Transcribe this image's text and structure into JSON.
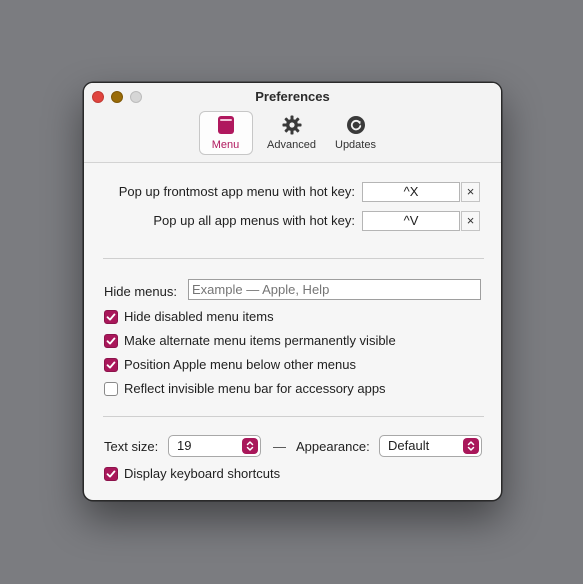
{
  "window": {
    "title": "Preferences"
  },
  "toolbar": {
    "items": [
      {
        "label": "Menu",
        "icon": "menu-book-icon",
        "selected": true
      },
      {
        "label": "Advanced",
        "icon": "gear-icon",
        "selected": false
      },
      {
        "label": "Updates",
        "icon": "update-refresh-icon",
        "selected": false
      }
    ]
  },
  "hotkeys": {
    "frontmost_label": "Pop up frontmost app menu with hot key:",
    "frontmost_value": "^X",
    "all_label": "Pop up all app menus with hot key:",
    "all_value": "^V",
    "clear_glyph": "×"
  },
  "hide_menus": {
    "label": "Hide menus:",
    "value": "",
    "placeholder": "Example — Apple, Help"
  },
  "options": [
    {
      "label": "Hide disabled menu items",
      "checked": true
    },
    {
      "label": "Make alternate menu items permanently visible",
      "checked": true
    },
    {
      "label": "Position Apple menu below other menus",
      "checked": true
    },
    {
      "label": "Reflect invisible menu bar for accessory apps",
      "checked": false
    }
  ],
  "text_size": {
    "label": "Text size:",
    "value": "19"
  },
  "separator": "—",
  "appearance": {
    "label": "Appearance:",
    "value": "Default"
  },
  "shortcuts": {
    "label": "Display keyboard shortcuts",
    "checked": true
  },
  "colors": {
    "accent": "#a9175a",
    "background": "#7b7c80",
    "window": "#f6f6f6"
  }
}
